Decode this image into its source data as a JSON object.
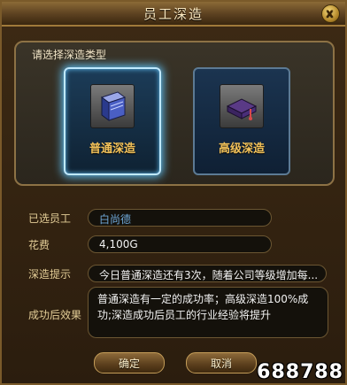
{
  "window": {
    "title": "员工深造",
    "close_symbol": "x"
  },
  "choose": {
    "prompt": "请选择深造类型",
    "options": [
      {
        "label": "普通深造",
        "icon": "blue-book-icon",
        "selected": true
      },
      {
        "label": "高级深造",
        "icon": "purple-book-icon",
        "selected": false
      }
    ]
  },
  "form": {
    "employee_label": "已选员工",
    "employee_value": "白尚德",
    "cost_label": "花费",
    "cost_value": "4,100G",
    "tip_label": "深造提示",
    "tip_value": "今日普通深造还有3次，随着公司等级增加每...",
    "effect_label": "成功后效果",
    "effect_value": "普通深造有一定的成功率；高级深造100%成功;深造成功后员工的行业经验将提升"
  },
  "buttons": {
    "confirm": "确定",
    "cancel": "取消"
  },
  "watermark": "688788",
  "colors": {
    "accent_gold": "#f2c25a",
    "selected_glow": "#5dbdf0",
    "name_blue": "#6ea6d6"
  }
}
